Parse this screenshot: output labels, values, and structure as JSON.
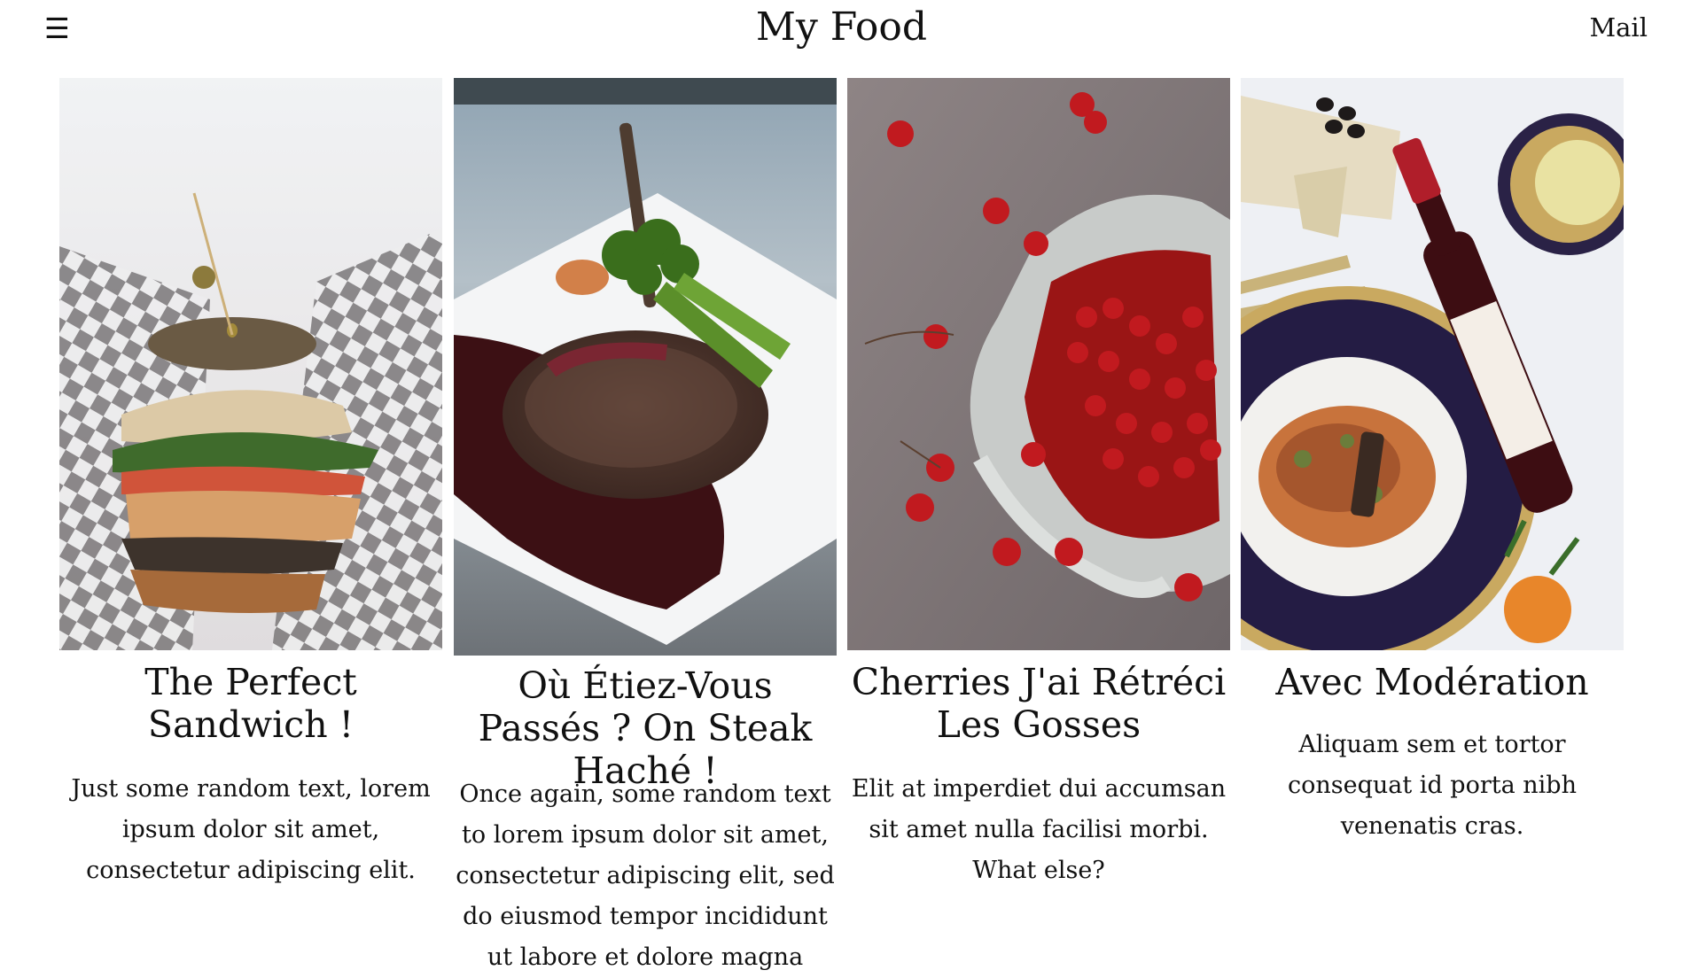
{
  "header": {
    "menu_label": "☰",
    "title": "My Food",
    "mail_label": "Mail"
  },
  "cards": [
    {
      "title": "The Perfect Sandwich !",
      "text": "Just some random text, lorem ipsum dolor sit amet, consectetur adipiscing elit."
    },
    {
      "title": "Où Étiez-Vous Passés ? On Steak Haché !",
      "text": "Once again, some random text to lorem ipsum dolor sit amet, consectetur adipiscing elit, sed do eiusmod tempor incididunt ut labore et dolore magna"
    },
    {
      "title": "Cherries J'ai Rétréci Les Gosses",
      "text": "Elit at imperdiet dui accumsan sit amet nulla facilisi morbi. What else?"
    },
    {
      "title": "Avec Modération",
      "text": "Aliquam sem et tortor consequat id porta nibh venenatis cras."
    }
  ]
}
